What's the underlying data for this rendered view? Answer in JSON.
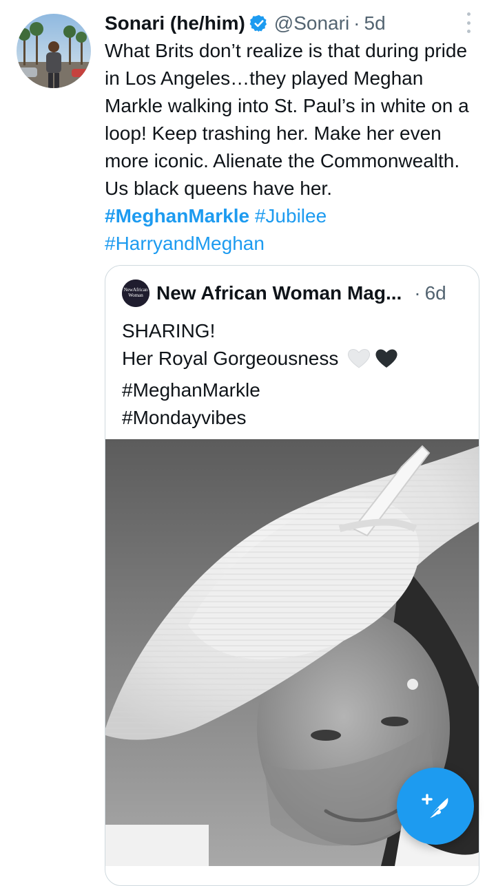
{
  "tweet": {
    "display_name": "Sonari (he/him)",
    "handle": "@Sonari",
    "separator": "·",
    "time": "5d",
    "text_plain": "What Brits don’t realize is that during pride in Los Angeles…they played Meghan Markle walking into St. Paul’s in white on a loop! Keep trashing her. Make her even more  iconic. Alienate the Commonwealth. Us black queens have her.",
    "hashtags": [
      "#MeghanMarkle",
      "#Jubilee",
      "#HarryandMeghan"
    ]
  },
  "quote": {
    "name": "New African Woman Mag...",
    "avatar_text": "NewAfrican Woman",
    "separator": "·",
    "time": "6d",
    "lines": [
      "SHARING!",
      "Her Royal Gorgeousness",
      "#MeghanMarkle",
      "#Mondayvibes"
    ],
    "hearts": [
      "white-heart",
      "black-heart"
    ]
  },
  "icons": {
    "verified": "verified-badge-icon",
    "more": "more-options-icon",
    "compose": "compose-tweet-icon"
  },
  "colors": {
    "accent": "#1d9bf0",
    "text": "#0f1419",
    "secondary": "#536471",
    "border": "#cfd9de"
  }
}
